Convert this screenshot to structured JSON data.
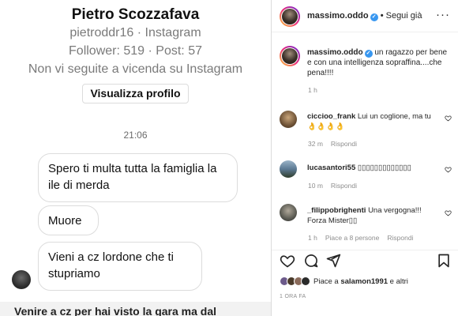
{
  "chat": {
    "profile_name": "Pietro Scozzafava",
    "profile_handle": "pietroddr16 · Instagram",
    "profile_stats": "Follower: 519 · Post: 57",
    "profile_relation": "Non vi seguite a vicenda su Instagram",
    "view_profile_label": "Visualizza profilo",
    "time": "21:06",
    "messages": [
      "Spero ti multa tutta la famiglia la ile di merda",
      "Muore",
      "Vieni a cz lordone che ti stupriamo"
    ],
    "bottom_cut_text": "Venire a cz per hai visto la gara ma dal"
  },
  "post": {
    "header": {
      "username": "massimo.oddo",
      "separator": "•",
      "follow_label": "Segui già",
      "more_label": "···"
    },
    "caption": {
      "username": "massimo.oddo",
      "text": "un ragazzo per bene e con una intelligenza sopraffina....che pena!!!!",
      "time": "1 h"
    },
    "comments": [
      {
        "username": "ciccioo_frank",
        "text": "Lui un coglione, ma tu 👌👌👌👌",
        "time": "32 m",
        "reply": "Rispondi",
        "likes": ""
      },
      {
        "username": "lucasantori55",
        "text": "▯▯▯▯▯▯▯▯▯▯▯▯▯",
        "time": "10 m",
        "reply": "Rispondi",
        "likes": ""
      },
      {
        "username": "_filippobrighenti",
        "text": "Una vergogna!!! Forza Mister▯▯",
        "time": "1 h",
        "reply": "Rispondi",
        "likes": "Piace a 8 persone"
      }
    ],
    "likes": {
      "prefix": "Piace a ",
      "user": "salamon1991",
      "suffix": " e altri"
    },
    "date": "1 ORA FA"
  },
  "colors": {
    "verified": "#3897f0",
    "meta_gray": "#8e8e8e",
    "text": "#262626",
    "border": "#dbdbdb"
  }
}
